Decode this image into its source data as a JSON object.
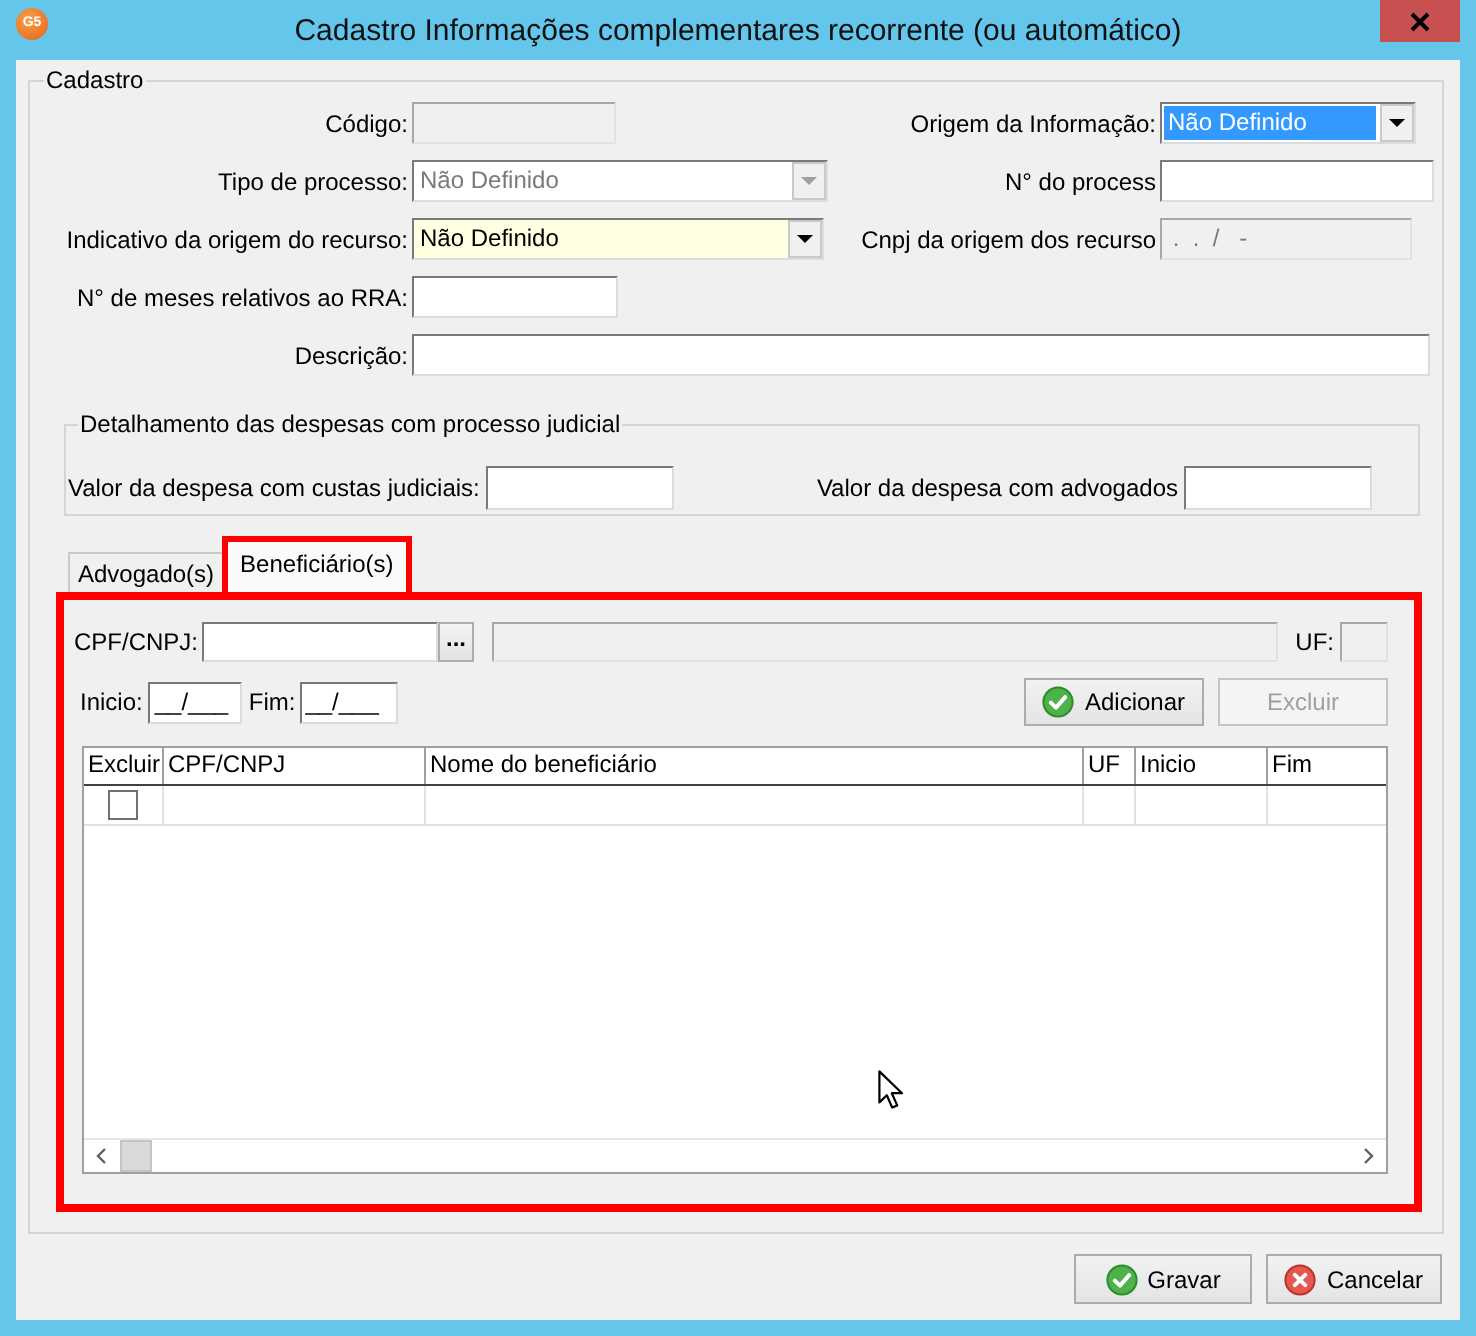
{
  "window": {
    "title": "Cadastro Informações complementares recorrente (ou automático)",
    "app_badge": "G5"
  },
  "cadastro": {
    "title": "Cadastro",
    "rows": [
      [
        {
          "label": "Código:",
          "kind": "text",
          "disabled": true,
          "focused": false,
          "highlighted": false
        },
        {
          "label": "Origem da Informação:",
          "kind": "select",
          "value": "Não Definido",
          "disabled": false,
          "focused": true,
          "highlighted": false
        }
      ],
      [
        {
          "label": "Tipo de processo:",
          "kind": "select",
          "value": "Não Definido",
          "disabled": true,
          "focused": false,
          "highlighted": false
        },
        {
          "label": "N° do process",
          "kind": "text",
          "disabled": false,
          "focused": false,
          "highlighted": false
        }
      ],
      [
        {
          "label": "Indicativo da origem do recurso:",
          "kind": "select",
          "value": "Não Definido",
          "disabled": false,
          "focused": false,
          "highlighted": true
        },
        {
          "label": "Cnpj da origem dos recurso",
          "kind": "text",
          "value": " .  .  /   -",
          "disabled": true,
          "focused": false,
          "highlighted": false
        }
      ],
      [
        {
          "label": "N° de meses relativos ao RRA:",
          "kind": "text",
          "disabled": false,
          "focused": false,
          "highlighted": false
        }
      ],
      [
        {
          "label": "Descrição:",
          "kind": "text",
          "disabled": false,
          "focused": false,
          "highlighted": false
        }
      ]
    ]
  },
  "despesas": {
    "title": "Detalhamento das despesas com processo judicial",
    "fields": [
      {
        "label": "Valor da despesa com custas judiciais:",
        "disabled": false
      },
      {
        "label": "Valor da despesa com advogados",
        "disabled": false
      }
    ]
  },
  "tabs": [
    {
      "label": "Advogado(s)",
      "selected": false,
      "highlighted": false
    },
    {
      "label": "Beneficiário(s)",
      "selected": true,
      "highlighted": true
    }
  ],
  "beneficiarios": {
    "highlighted": true,
    "cpf": {
      "label": "CPF/CNPJ:",
      "lookup_button": "...",
      "disabled": false
    },
    "name_field": {
      "disabled": true
    },
    "uf": {
      "label": "UF:",
      "disabled": true
    },
    "inicio": {
      "label": "Inicio:",
      "value": "__/___"
    },
    "fim": {
      "label": "Fim:",
      "value": "__/___"
    },
    "buttons": [
      {
        "label": "Adicionar",
        "kind": "add",
        "disabled": false
      },
      {
        "label": "Excluir",
        "kind": "remove",
        "disabled": true
      }
    ],
    "grid": {
      "columns": [
        "Excluir",
        "CPF/CNPJ",
        "Nome do beneficiário",
        "UF",
        "Inicio",
        "Fim"
      ],
      "rows": [
        {
          "checked": false
        }
      ]
    }
  },
  "buttons": [
    {
      "label": "Gravar",
      "kind": "save",
      "disabled": false
    },
    {
      "label": "Cancelar",
      "kind": "cancel",
      "disabled": false
    }
  ]
}
